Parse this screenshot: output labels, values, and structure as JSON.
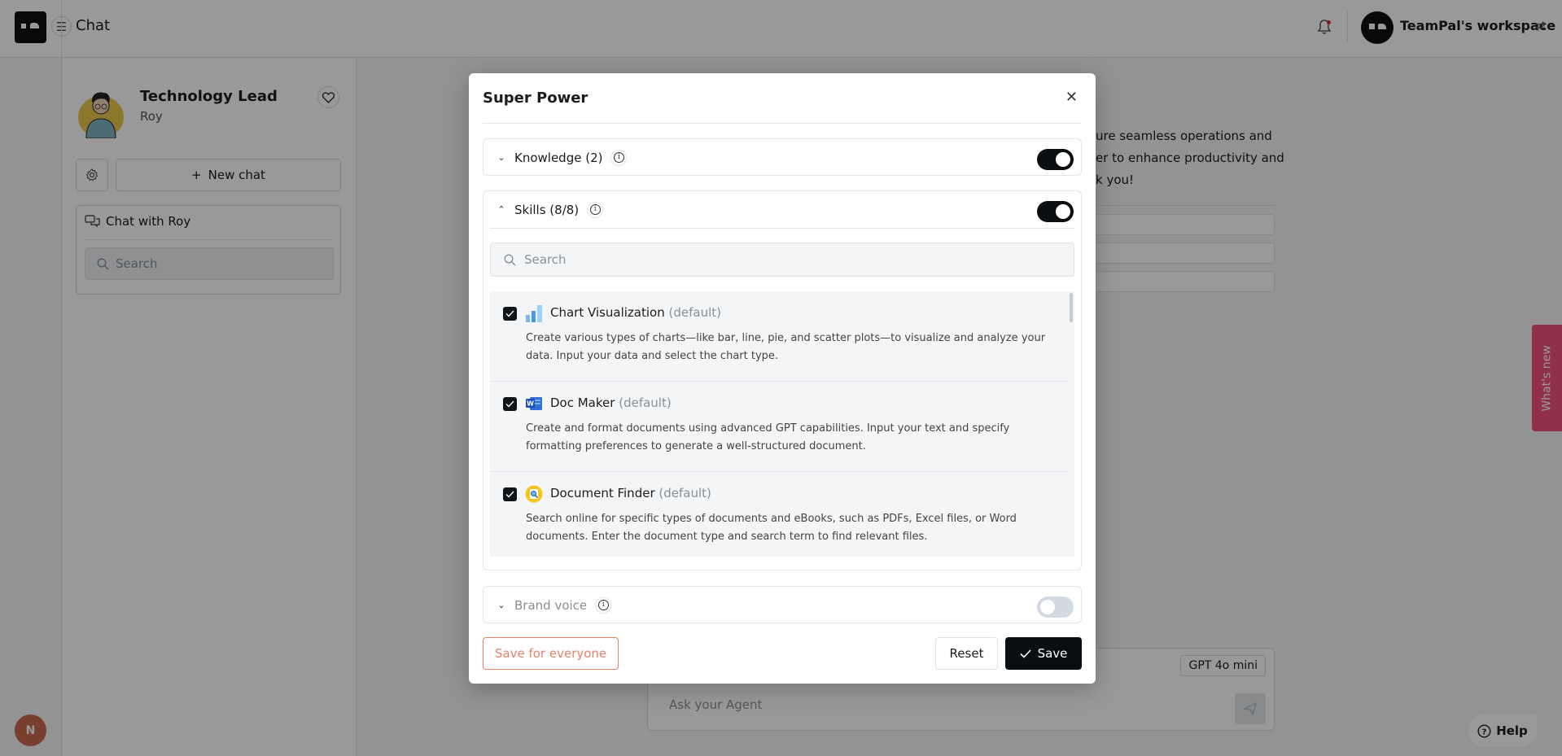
{
  "topbar": {
    "title": "Chat",
    "workspace_name": "TeamPal's workspace",
    "icons": {
      "logo": "teampal-logo",
      "menu": "hamburger-icon",
      "notifications": "bell-icon",
      "switch": "switch-arrows-icon"
    }
  },
  "sidebar": {
    "agent_title": "Technology Lead",
    "agent_name": "Roy",
    "new_chat_label": "New chat",
    "chat_list_title": "Chat with Roy",
    "search_placeholder": "Search",
    "user_initial": "N"
  },
  "chat": {
    "visible_text_fragments": [
      "…ure seamless operations and",
      "…er to enhance productivity and",
      "…k you!"
    ],
    "model_label": "GPT 4o mini",
    "input_placeholder": "Ask your Agent"
  },
  "floating": {
    "whats_new_label": "What's new",
    "help_label": "Help"
  },
  "modal": {
    "title": "Super Power",
    "sections": [
      {
        "label": "Knowledge (2)",
        "expanded": false,
        "enabled": true
      },
      {
        "label": "Skills (8/8)",
        "expanded": true,
        "enabled": true
      },
      {
        "label": "Brand voice",
        "expanded": false,
        "enabled": false
      }
    ],
    "skills_search_placeholder": "Search",
    "default_tag": "(default)",
    "skills": [
      {
        "name": "Chart Visualization",
        "checked": true,
        "icon": "bar-chart-icon",
        "description": "Create various types of charts—like bar, line, pie, and scatter plots—to visualize and analyze your data. Input your data and select the chart type."
      },
      {
        "name": "Doc Maker",
        "checked": true,
        "icon": "word-doc-icon",
        "description": "Create and format documents using advanced GPT capabilities. Input your text and specify formatting preferences to generate a well-structured document."
      },
      {
        "name": "Document Finder",
        "checked": true,
        "icon": "document-search-icon",
        "description": "Search online for specific types of documents and eBooks, such as PDFs, Excel files, or Word documents. Enter the document type and search term to find relevant files."
      }
    ],
    "buttons": {
      "save_everyone": "Save for everyone",
      "reset": "Reset",
      "save": "Save"
    }
  },
  "colors": {
    "accent_dark": "#0b0e10",
    "save_everyone": "#e8806c",
    "whats_new": "#f0507a",
    "user_avatar": "#c96a4d"
  }
}
